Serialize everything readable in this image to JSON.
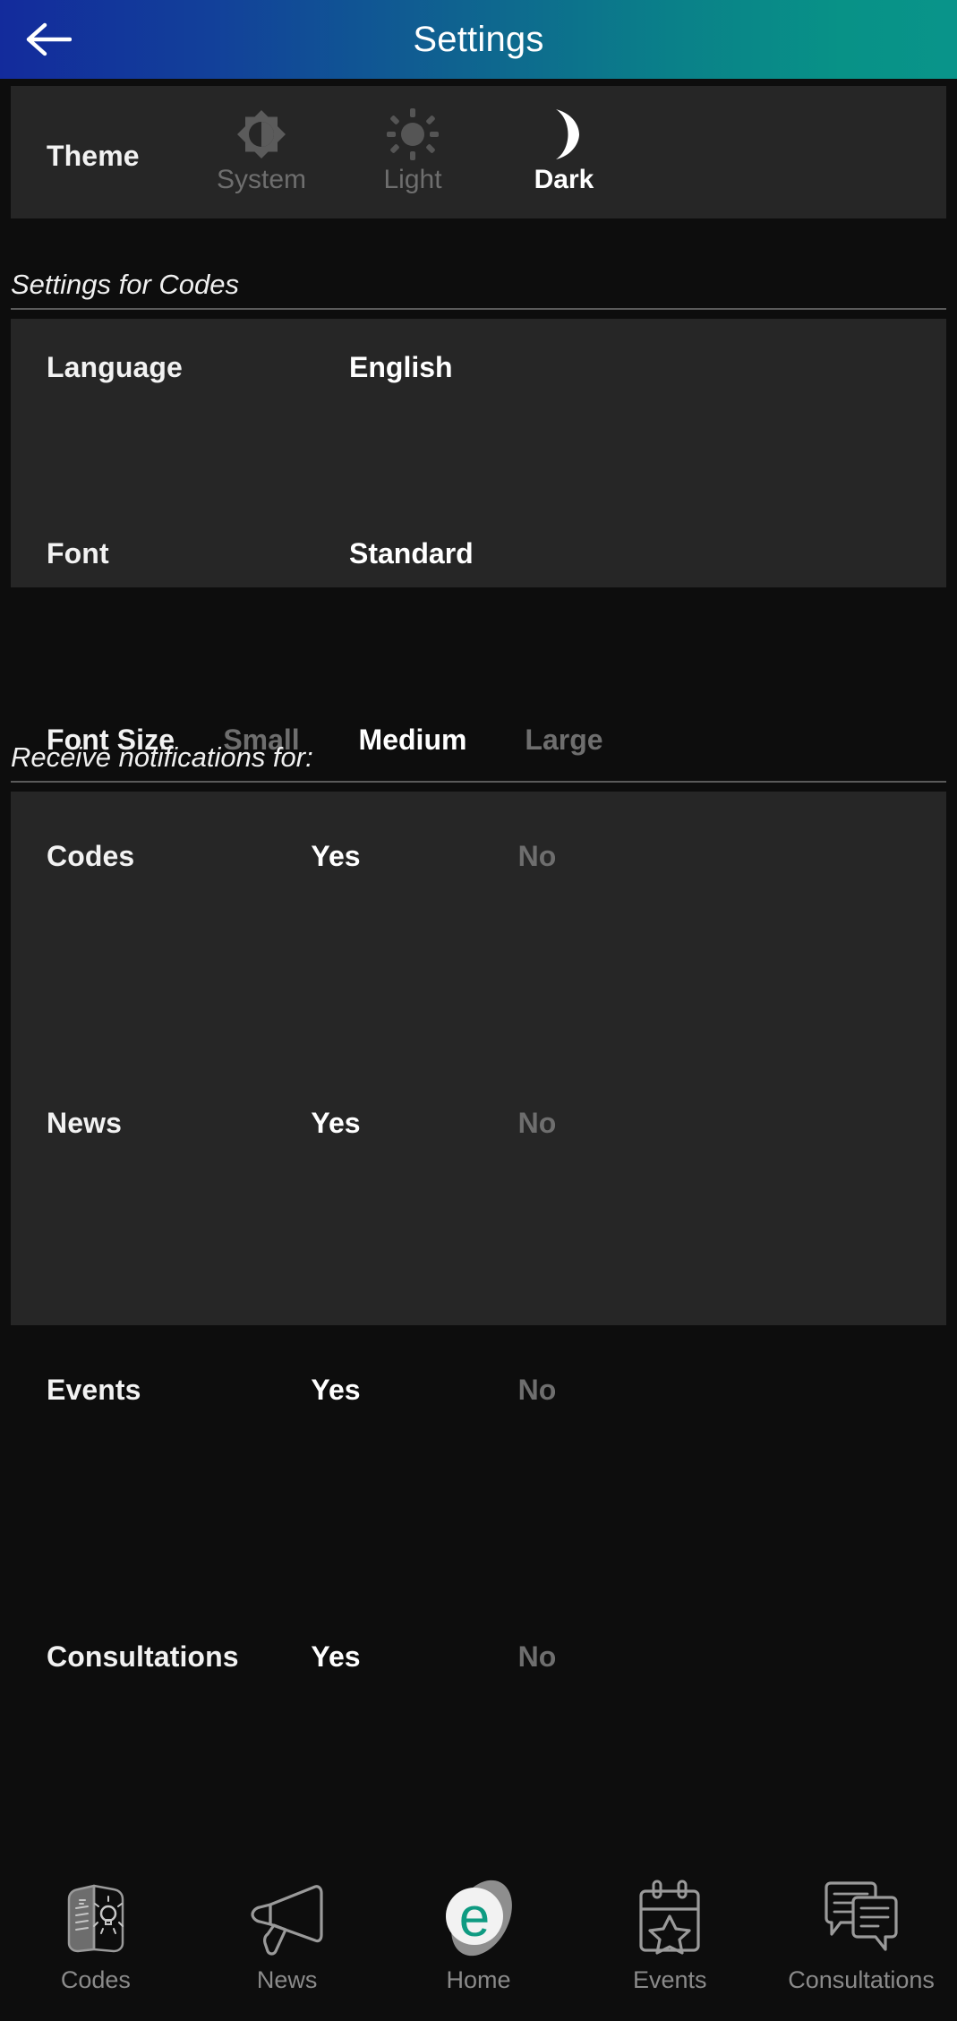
{
  "header": {
    "title": "Settings",
    "back_icon": "arrow-left-icon",
    "gradient_start": "#132b9c",
    "gradient_end": "#09948a"
  },
  "theme": {
    "label": "Theme",
    "selected": "Dark",
    "options": [
      {
        "label": "System",
        "icon": "brightness-auto-icon",
        "selected": false
      },
      {
        "label": "Light",
        "icon": "sun-icon",
        "selected": false
      },
      {
        "label": "Dark",
        "icon": "moon-icon",
        "selected": true
      }
    ]
  },
  "sections": {
    "codes_title": "Settings for Codes",
    "notifications_title": "Receive notifications for:"
  },
  "codes_settings": {
    "language": {
      "label": "Language",
      "value": "English"
    },
    "font": {
      "label": "Font",
      "value": "Standard"
    },
    "font_size": {
      "label": "Font Size",
      "selected": "Medium",
      "options": [
        {
          "label": "Small",
          "selected": false
        },
        {
          "label": "Medium",
          "selected": true
        },
        {
          "label": "Large",
          "selected": false
        }
      ]
    }
  },
  "notifications": {
    "yes_label": "Yes",
    "no_label": "No",
    "rows": [
      {
        "label": "Codes",
        "selected": "Yes"
      },
      {
        "label": "News",
        "selected": "Yes"
      },
      {
        "label": "Events",
        "selected": "Yes"
      },
      {
        "label": "Consultations",
        "selected": "Yes"
      }
    ]
  },
  "bottom_nav": {
    "active": "Home",
    "items": [
      {
        "label": "Codes",
        "icon": "book-lightbulb-icon"
      },
      {
        "label": "News",
        "icon": "megaphone-icon"
      },
      {
        "label": "Home",
        "icon": "e-logo-icon"
      },
      {
        "label": "Events",
        "icon": "calendar-star-icon"
      },
      {
        "label": "Consultations",
        "icon": "speech-bubbles-icon"
      }
    ]
  },
  "colors": {
    "page_background": "#0d0d0d",
    "card_background": "#262626",
    "selected_text": "#ffffff",
    "unselected_text": "#6e6e6e",
    "accent_teal": "#0f9b82",
    "divider": "#5a5a5a"
  }
}
